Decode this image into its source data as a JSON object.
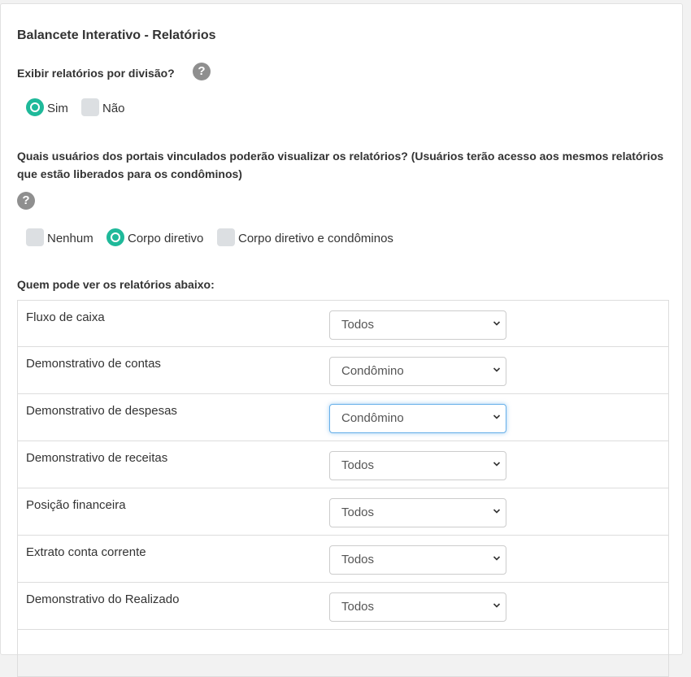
{
  "title": "Balancete Interativo - Relatórios",
  "division_question": {
    "label": "Exibir relatórios por divisão?",
    "help_icon": "question-circle-icon",
    "options": [
      {
        "label": "Sim",
        "checked": true
      },
      {
        "label": "Não",
        "checked": false
      }
    ]
  },
  "portal_question": {
    "label": "Quais usuários dos portais vinculados poderão visualizar os relatórios? (Usuários terão acesso aos mesmos relatórios que estão liberados para os condôminos)",
    "help_icon": "question-circle-icon",
    "options": [
      {
        "label": "Nenhum",
        "checked": false
      },
      {
        "label": "Corpo diretivo",
        "checked": true
      },
      {
        "label": "Corpo diretivo e condôminos",
        "checked": false
      }
    ]
  },
  "reports_section": {
    "label": "Quem pode ver os relatórios abaixo:",
    "rows": [
      {
        "name": "Fluxo de caixa",
        "value": "Todos"
      },
      {
        "name": "Demonstrativo de contas",
        "value": "Condômino"
      },
      {
        "name": "Demonstrativo de despesas",
        "value": "Condômino"
      },
      {
        "name": "Demonstrativo de receitas",
        "value": "Todos"
      },
      {
        "name": "Posição financeira",
        "value": "Todos"
      },
      {
        "name": "Extrato conta corrente",
        "value": "Todos"
      },
      {
        "name": "Demonstrativo do Realizado",
        "value": "Todos"
      }
    ]
  },
  "colors": {
    "accent": "#1fb99a",
    "help_icon": "#8f8f8f",
    "focus_border": "#66afe9"
  }
}
